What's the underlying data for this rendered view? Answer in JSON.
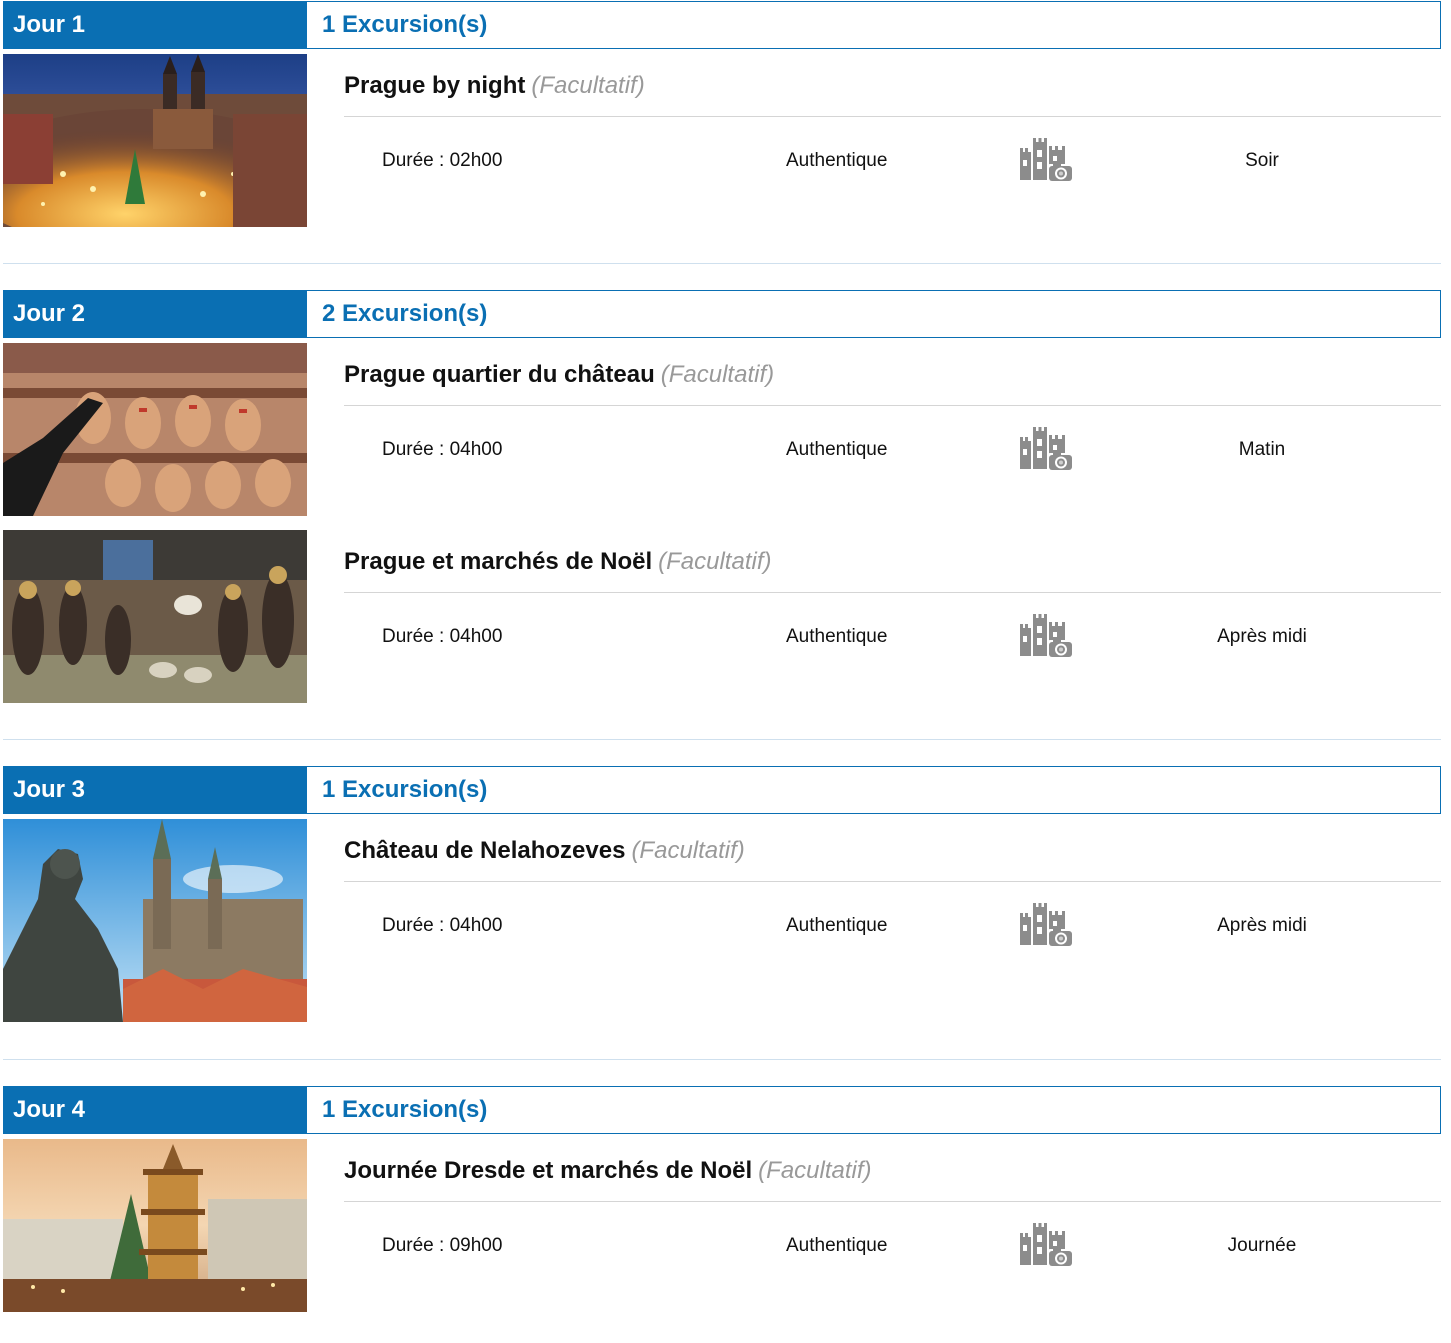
{
  "optional_label": "(Facultatif)",
  "days": [
    {
      "label": "Jour 1",
      "excursion_count": "1 Excursion(s)",
      "excursions": [
        {
          "title": "Prague by night",
          "duration": "Durée : 02h00",
          "type": "Authentique",
          "icon": "castle-camera-icon",
          "period": "Soir",
          "photo": "prague-old-town-christmas-night"
        }
      ]
    },
    {
      "label": "Jour 2",
      "excursion_count": "2 Excursion(s)",
      "excursions": [
        {
          "title": "Prague quartier du château",
          "duration": "Durée : 04h00",
          "type": "Authentique",
          "icon": "castle-camera-icon",
          "period": "Matin",
          "photo": "gingerbread-market-stall"
        },
        {
          "title": "Prague et marchés de Noël",
          "duration": "Durée : 04h00",
          "type": "Authentique",
          "icon": "castle-camera-icon",
          "period": "Après midi",
          "photo": "nativity-figurines"
        }
      ]
    },
    {
      "label": "Jour 3",
      "excursion_count": "1 Excursion(s)",
      "excursions": [
        {
          "title": "Château de Nelahozeves",
          "duration": "Durée : 04h00",
          "type": "Authentique",
          "icon": "castle-camera-icon",
          "period": "Après midi",
          "photo": "statue-and-cathedral"
        }
      ]
    },
    {
      "label": "Jour 4",
      "excursion_count": "1 Excursion(s)",
      "excursions": [
        {
          "title": "Journée Dresde et marchés de Noël",
          "duration": "Durée : 09h00",
          "type": "Authentique",
          "icon": "castle-camera-icon",
          "period": "Journée",
          "photo": "dresden-christmas-pyramid"
        }
      ]
    }
  ]
}
